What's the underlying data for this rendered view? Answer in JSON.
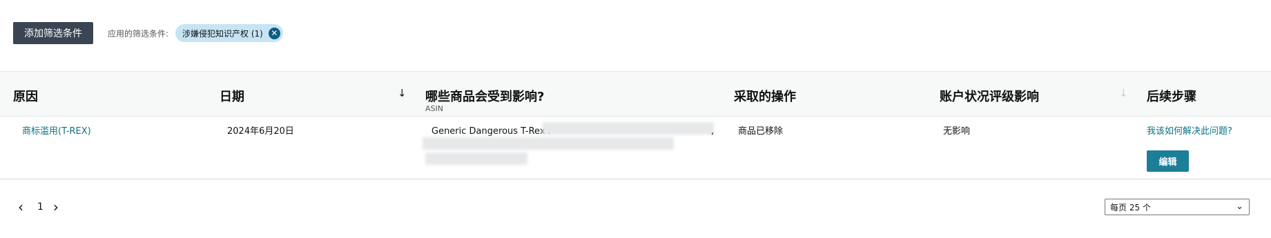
{
  "filters": {
    "add_button": "添加筛选条件",
    "applied_label": "应用的筛选条件:",
    "chip_label": "涉嫌侵犯知识产权 (1)",
    "chip_close_icon": "close-circle-icon"
  },
  "table": {
    "headers": {
      "reason": "原因",
      "date": "日期",
      "affected_items": "哪些商品会受到影响?",
      "affected_items_sub": "ASIN",
      "action": "采取的操作",
      "health_impact": "账户状况评级影响",
      "next_steps": "后续步骤"
    },
    "date_sort_icon": "arrow-down-icon",
    "health_sort_icon": "arrow-down-icon",
    "rows": [
      {
        "reason": "商标滥用(T-REX)",
        "date": "2024年6月20日",
        "item": "Generic Dangerous T-Rex i",
        "item_comma": ",",
        "action": "商品已移除",
        "health_impact": "无影响",
        "resolve_link": "我该如何解决此问题?",
        "edit_button": "编辑"
      }
    ]
  },
  "pagination": {
    "prev_icon": "chevron-left-icon",
    "next_icon": "chevron-right-icon",
    "current_page": "1",
    "per_page": "每页 25 个",
    "per_page_icon": "chevron-down-icon"
  },
  "colors": {
    "button_dark": "#3a4553",
    "chip_bg": "#c7e4f5",
    "link": "#0b7285",
    "edit_button": "#1b7f9a"
  }
}
